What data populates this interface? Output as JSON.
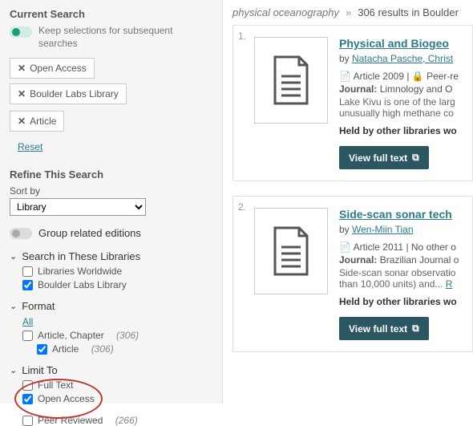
{
  "sidebar": {
    "current_search_title": "Current Search",
    "keep_text": "Keep selections for subsequent searches",
    "pills": [
      "Open Access",
      "Boulder Labs Library",
      "Article"
    ],
    "reset": "Reset",
    "refine_title": "Refine This Search",
    "sortby_label": "Sort by",
    "sortby_value": "Library",
    "group_label": "Group related editions",
    "facets": {
      "libraries": {
        "head": "Search in These Libraries",
        "items": [
          {
            "label": "Libraries Worldwide",
            "checked": false
          },
          {
            "label": "Boulder Labs Library",
            "checked": true
          }
        ]
      },
      "format": {
        "head": "Format",
        "all": "All",
        "items": [
          {
            "label": "Article, Chapter",
            "count": "(306)",
            "checked": false,
            "indent": false
          },
          {
            "label": "Article",
            "count": "(306)",
            "checked": true,
            "indent": true
          }
        ]
      },
      "limit": {
        "head": "Limit To",
        "items": [
          {
            "label": "Full Text",
            "checked": false
          },
          {
            "label": "Open Access",
            "checked": true
          },
          {
            "label": "Peer Reviewed",
            "count": "(266)",
            "checked": false
          }
        ]
      }
    }
  },
  "breadcrumb": {
    "query": "physical oceanography",
    "results": "306 results in Boulder"
  },
  "results": [
    {
      "num": "1.",
      "title": "Physical and Biogeo",
      "by_prefix": "by ",
      "authors": "Natacha Pasche, Christ",
      "meta": "Article 2009 | ",
      "peer": "Peer-re",
      "journal_label": "Journal:",
      "journal": "Limnology and O",
      "desc": "Lake Kivu is one of the larg unusually high methane co",
      "held": "Held by other libraries wo",
      "btn": "View full text"
    },
    {
      "num": "2.",
      "title": "Side-scan sonar tech",
      "by_prefix": "by ",
      "authors": "Wen-Miin Tian",
      "meta": "Article 2011 | No other o",
      "peer": "",
      "journal_label": "Journal:",
      "journal": "Brazilian Journal o",
      "desc": "Side-scan sonar observatio than 10,000 units) and...",
      "more": "R",
      "held": "Held by other libraries wo",
      "btn": "View full text"
    }
  ]
}
